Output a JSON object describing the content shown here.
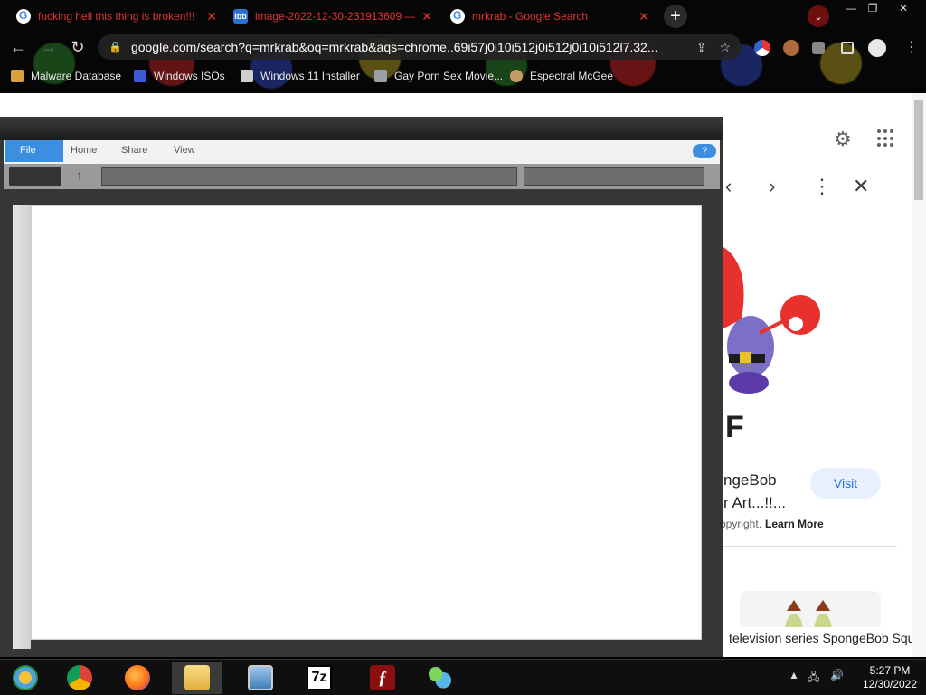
{
  "browser": {
    "tabs": [
      {
        "label": "fucking hell this thing is broken!!!",
        "close": "✕",
        "icon": "google-icon"
      },
      {
        "label": "image-2022-12-30-231913609 —",
        "close": "✕",
        "icon": "ibb-icon",
        "icon_text": "ibb"
      },
      {
        "label": "mrkrab - Google Search",
        "close": "✕",
        "icon": "google-icon"
      }
    ],
    "new_tab": "+",
    "tab_search": "⌄",
    "window_controls": {
      "minimize": "—",
      "restore": "❐",
      "close": "✕"
    },
    "nav": {
      "back": "←",
      "forward": "→",
      "reload": "↻",
      "home": "⌂"
    },
    "url": "google.com/search?q=mrkrab&oq=mrkrab&aqs=chrome..69i57j0i10i512j0i512j0i10i512l7.32...",
    "bookmarks": [
      {
        "label": "Malware Database",
        "icon": "folder-icon",
        "color": "#d9a23a"
      },
      {
        "label": "Windows ISOs",
        "icon": "x-icon",
        "color": "#3b5bdb"
      },
      {
        "label": "Windows 11 Installer",
        "icon": "page-icon",
        "color": "#cfcfcf"
      },
      {
        "label": "Gay Porn Sex Movie...",
        "icon": "site-icon",
        "color": "#9aa0a6"
      },
      {
        "label": "Espectral McGee",
        "icon": "avatar-icon",
        "color": "#c79a6a"
      }
    ]
  },
  "google": {
    "result_title_line1": "ngeBob",
    "result_title_line2": "r Art...!!...",
    "visit_label": "Visit",
    "copyright_text": "opyright.",
    "learn_more": "Learn More",
    "caption": "television series SpongeBob Squ",
    "panel_logo_text": "F"
  },
  "explorer": {
    "ribbon_tabs": [
      "File",
      "Home",
      "Share",
      "View"
    ],
    "help": "?"
  },
  "taskbar": {
    "time": "5:27 PM",
    "date": "12/30/2022",
    "apps": [
      {
        "name": "start-button",
        "color": "#4aa3df"
      },
      {
        "name": "chrome",
        "color": "#e0b21d"
      },
      {
        "name": "firefox",
        "color": "#ff7a18"
      },
      {
        "name": "file-explorer",
        "color": "#f1c75b"
      },
      {
        "name": "photos",
        "color": "#5a8fc9"
      },
      {
        "name": "7zip",
        "color": "#ffffff"
      },
      {
        "name": "flash",
        "color": "#c81e1e"
      },
      {
        "name": "messenger",
        "color": "#56b4e9"
      }
    ],
    "sevenzip_label": "7z",
    "flash_label": "ƒ"
  }
}
